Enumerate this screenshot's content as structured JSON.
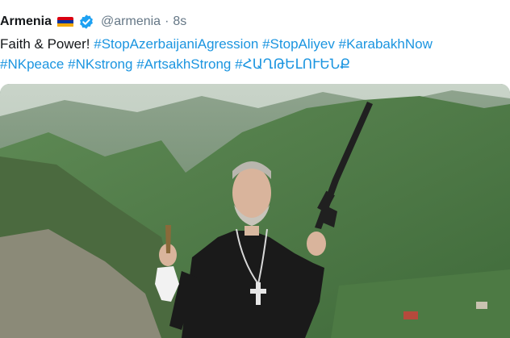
{
  "tweet": {
    "author_name": "Armenia",
    "handle": "@armenia",
    "separator": "·",
    "time": "8s",
    "text_intro": "Faith & Power!",
    "hashtags_line1": [
      "#StopAzerbaijaniAgression",
      "#StopAliyev",
      "#KarabakhNow"
    ],
    "hashtags_line2": [
      "#NKpeace",
      "#NKstrong",
      "#ArtsakhStrong",
      "#ՀԱՂԹԵԼՈՒԵՆՔ"
    ]
  },
  "colors": {
    "hashtag": "#1b95e0",
    "verified_badge": "#1da1f2",
    "flag_stripes": [
      "#d90012",
      "#0033a0",
      "#f2a800"
    ]
  },
  "icons": {
    "verified": "verified-badge-icon",
    "flag": "armenian-flag-icon"
  },
  "media": {
    "type": "photo",
    "subject": "priest holding a cross and a rifle on a mountainside"
  }
}
